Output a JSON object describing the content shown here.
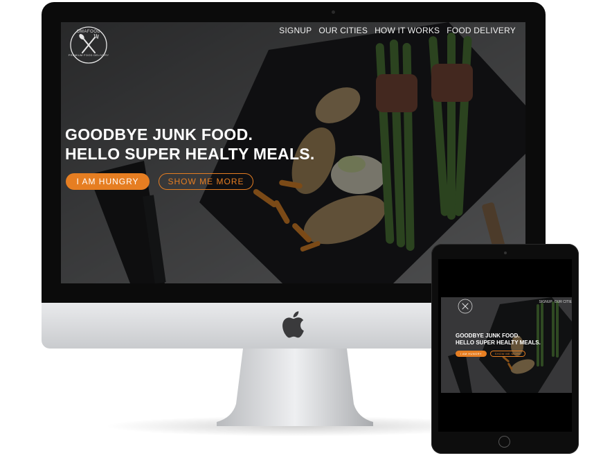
{
  "brand": {
    "name": "OMAFOOD",
    "tagline": "PREMIUM FOOD DELIVERY",
    "accent_color": "#e67e22"
  },
  "nav": {
    "items": [
      {
        "label": "SIGNUP"
      },
      {
        "label": "OUR CITIES"
      },
      {
        "label": "HOW IT WORKS"
      },
      {
        "label": "FOOD DELIVERY"
      }
    ]
  },
  "hero": {
    "headline_line1": "GOODBYE JUNK FOOD.",
    "headline_line2": "HELLO SUPER HEALTY MEALS.",
    "primary_button": "I AM HUNGRY",
    "secondary_button": "SHOW ME MORE"
  },
  "tablet": {
    "nav_items": [
      {
        "label": "SIGNUP"
      },
      {
        "label": "OUR CITIE"
      }
    ],
    "headline_line1": "GOODBYE JUNK FOOD.",
    "headline_line2": "HELLO SUPER HEALTY MEALS.",
    "primary_button": "I AM HUNGRY",
    "secondary_button": "SHOW ME MORE"
  },
  "icons": {
    "logo": "fork-spoon-icon",
    "device_brand": "apple-logo-icon"
  }
}
